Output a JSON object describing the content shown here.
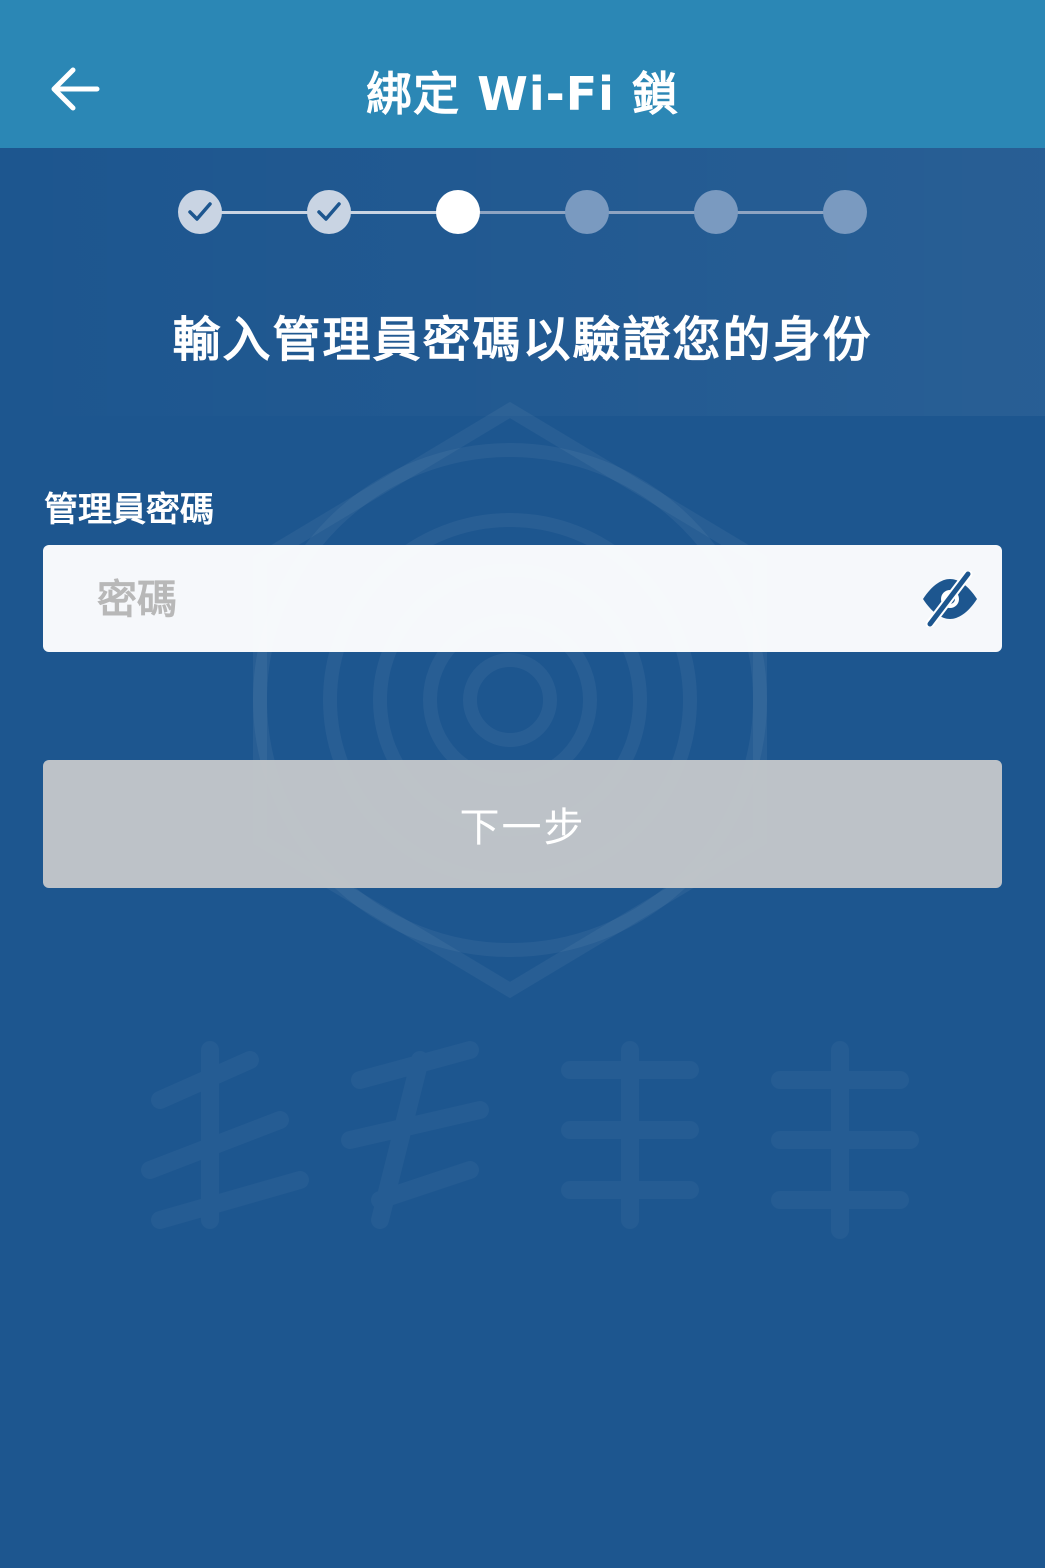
{
  "header": {
    "title": "綁定 Wi-Fi 鎖",
    "back_icon": "arrow-left-icon"
  },
  "stepper": {
    "total_steps": 6,
    "completed_steps": 2,
    "current_step": 3
  },
  "prompt": "輸入管理員密碼以驗證您的身份",
  "password": {
    "label": "管理員密碼",
    "placeholder": "密碼",
    "value": "",
    "toggle_icon": "eye-off-icon"
  },
  "next_button": {
    "label": "下一步"
  },
  "colors": {
    "header": "#2b87b5",
    "background": "#1d568f",
    "accent": "#1d568f",
    "button_disabled": "#c4c7ca"
  }
}
